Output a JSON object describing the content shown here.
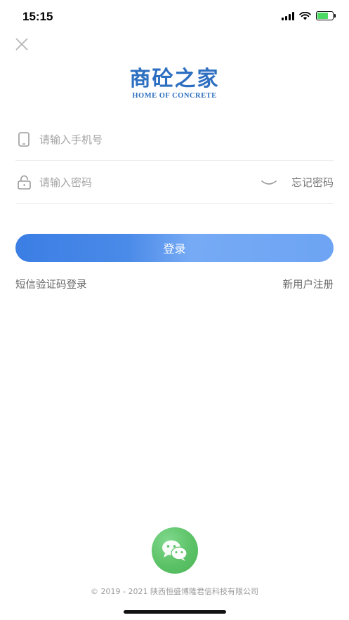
{
  "status_bar": {
    "time": "15:15"
  },
  "logo": {
    "title_cn": "商砼之家",
    "title_en": "HOME OF CONCRETE"
  },
  "form": {
    "phone": {
      "placeholder": "请输入手机号",
      "value": "",
      "icon": "phone-icon"
    },
    "password": {
      "placeholder": "请输入密码",
      "value": "",
      "icon": "lock-icon"
    },
    "forgot_label": "忘记密码"
  },
  "actions": {
    "login_label": "登录",
    "sms_login_label": "短信验证码登录",
    "register_label": "新用户注册"
  },
  "wechat": {
    "icon": "wechat-icon"
  },
  "footer": {
    "copyright": "© 2019 - 2021 陕西恒盛博隆君信科技有限公司"
  },
  "colors": {
    "accent": "#3b7ee4",
    "logo": "#2d6fc0",
    "wechat": "#5cc267"
  }
}
